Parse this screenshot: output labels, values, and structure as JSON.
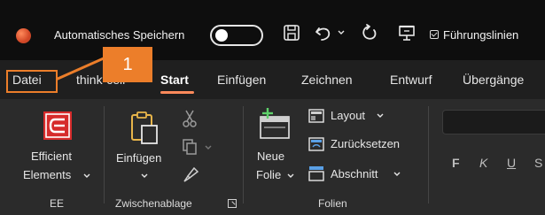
{
  "titlebar": {
    "autosave_label": "Automatisches Speichern",
    "fuehrungslinien_label": "Führungslinien"
  },
  "tabs": [
    {
      "label": "Datei"
    },
    {
      "label": "think-cell"
    },
    {
      "label": "Start",
      "active": true
    },
    {
      "label": "Einfügen"
    },
    {
      "label": "Zeichnen"
    },
    {
      "label": "Entwurf"
    },
    {
      "label": "Übergänge"
    }
  ],
  "callout": {
    "number": "1",
    "color": "#ec7e2a"
  },
  "ribbon": {
    "ee": {
      "button_line1": "Efficient",
      "button_line2": "Elements",
      "group_label": "EE"
    },
    "clipboard": {
      "paste_label": "Einfügen",
      "group_label": "Zwischenablage"
    },
    "slides": {
      "new_slide_line1": "Neue",
      "new_slide_line2": "Folie",
      "layout_label": "Layout",
      "reset_label": "Zurücksetzen",
      "section_label": "Abschnitt",
      "group_label": "Folien"
    },
    "font": {
      "bold": "F",
      "italic": "K",
      "underline": "U",
      "strike": "S"
    }
  },
  "colors": {
    "accent": "#ec7e2a",
    "ee_red": "#d62b2b",
    "tab_underline": "#ff8a5b"
  }
}
